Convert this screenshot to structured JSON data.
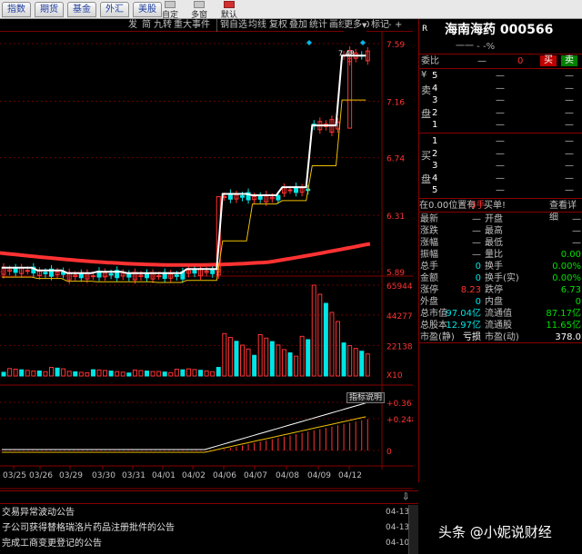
{
  "top_tabs": [
    "指数",
    "期货",
    "基金",
    "外汇",
    "美股"
  ],
  "top_buttons": [
    "自定",
    "多窗",
    "默认"
  ],
  "chart_tools": {
    "items": [
      "发",
      "简",
      "九转",
      "重大事件",
      "钢自选",
      "均线",
      "复权",
      "叠加",
      "统计",
      "画线",
      "F10",
      "标记",
      "-",
      "+",
      "更多"
    ],
    "more_marker": "▼"
  },
  "price_axis": [
    "7.59",
    "7.16",
    "6.74",
    "6.31",
    "5.89"
  ],
  "volume_axis": [
    "65944",
    "44277",
    "22138",
    "X10"
  ],
  "indicator_axis": [
    "+0.367",
    "+0.248",
    "0"
  ],
  "indicator_button": "指标说明",
  "peak_label": "7.48",
  "dates": [
    "03/25",
    "03/26",
    "03/29",
    "03/30",
    "03/31",
    "04/01",
    "04/02",
    "04/06",
    "04/07",
    "04/08",
    "04/09",
    "04/12"
  ],
  "chart_data": [
    {
      "type": "line",
      "x": [
        "03/25",
        "03/26",
        "03/29",
        "03/30",
        "03/31",
        "04/01",
        "04/02",
        "04/06",
        "04/07",
        "04/08",
        "04/09",
        "04/12"
      ],
      "ylim": [
        5.79,
        7.59
      ],
      "series": [
        {
          "values": [
            5.9,
            5.88,
            5.86,
            5.87,
            5.86,
            5.86,
            5.89,
            6.45,
            6.44,
            6.5,
            6.96,
            7.48
          ]
        }
      ]
    },
    {
      "type": "bar",
      "categories": [
        "03/25",
        "03/26",
        "03/29",
        "03/30",
        "03/31",
        "04/01",
        "04/02",
        "04/06",
        "04/07",
        "04/08",
        "04/09",
        "04/12"
      ],
      "ylim": [
        0,
        65944
      ],
      "series": [
        {
          "values": [
            4500,
            5200,
            3800,
            4000,
            3600,
            4100,
            5200,
            28000,
            25000,
            24000,
            65944,
            20000
          ]
        }
      ]
    }
  ],
  "panel": {
    "code_prefix": "R",
    "title": "海南海药 000566",
    "sub": "一一 - -%",
    "weibi_label": "委比",
    "weibi_value": "0",
    "buy_btn": "买",
    "sell_btn": "卖",
    "sell_labels": [
      "卖",
      "盘"
    ],
    "buy_labels": [
      "买",
      "盘"
    ],
    "sell_levels": [
      "5",
      "4",
      "3",
      "2",
      "1"
    ],
    "buy_levels": [
      "1",
      "2",
      "3",
      "4",
      "5"
    ],
    "dash": "—",
    "level_vol": "—",
    "yen": "¥",
    "position": "在0.00位置有",
    "position_hand": "0手",
    "position_tail": "买单!",
    "detail_link": "查看详细",
    "stats": [
      {
        "l": "最新",
        "lv": "—",
        "r": "开盘",
        "rv": "—"
      },
      {
        "l": "涨跌",
        "lv": "—",
        "r": "最高",
        "rv": "—"
      },
      {
        "l": "涨幅",
        "lv": "—",
        "r": "最低",
        "rv": "—"
      },
      {
        "l": "振幅",
        "lv": "—",
        "r": "量比",
        "rv": "0.00"
      },
      {
        "l": "总手",
        "lv": "0",
        "r": "换手",
        "rv": "0.00%"
      },
      {
        "l": "金额",
        "lv": "0",
        "r": "换手(实)",
        "rv": "0.00%"
      },
      {
        "l": "涨停",
        "lv": "8.23",
        "r": "跌停",
        "rv": "6.73"
      },
      {
        "l": "外盘",
        "lv": "0",
        "r": "内盘",
        "rv": "0"
      },
      {
        "l": "总市值",
        "lv": "97.04亿",
        "r": "流通值",
        "rv": "87.17亿"
      },
      {
        "l": "总股本",
        "lv": "12.97亿",
        "r": "流通股",
        "rv": "11.65亿"
      },
      {
        "l": "市盈(静)",
        "lv": "亏损",
        "r": "市盈(动)",
        "rv": "378.0"
      }
    ]
  },
  "news": [
    {
      "title": "交易异常波动公告",
      "date": "04-13"
    },
    {
      "title": "子公司获得替格瑞洛片药品注册批件的公告",
      "date": "04-13"
    },
    {
      "title": "完成工商变更登记的公告",
      "date": "04-10"
    }
  ],
  "watermark": "头条 @小妮说财经",
  "colors": {
    "up": "#ff3232",
    "down": "#00e5e5",
    "ma": "#f0c000",
    "border": "#800000",
    "white": "#ffffff"
  }
}
